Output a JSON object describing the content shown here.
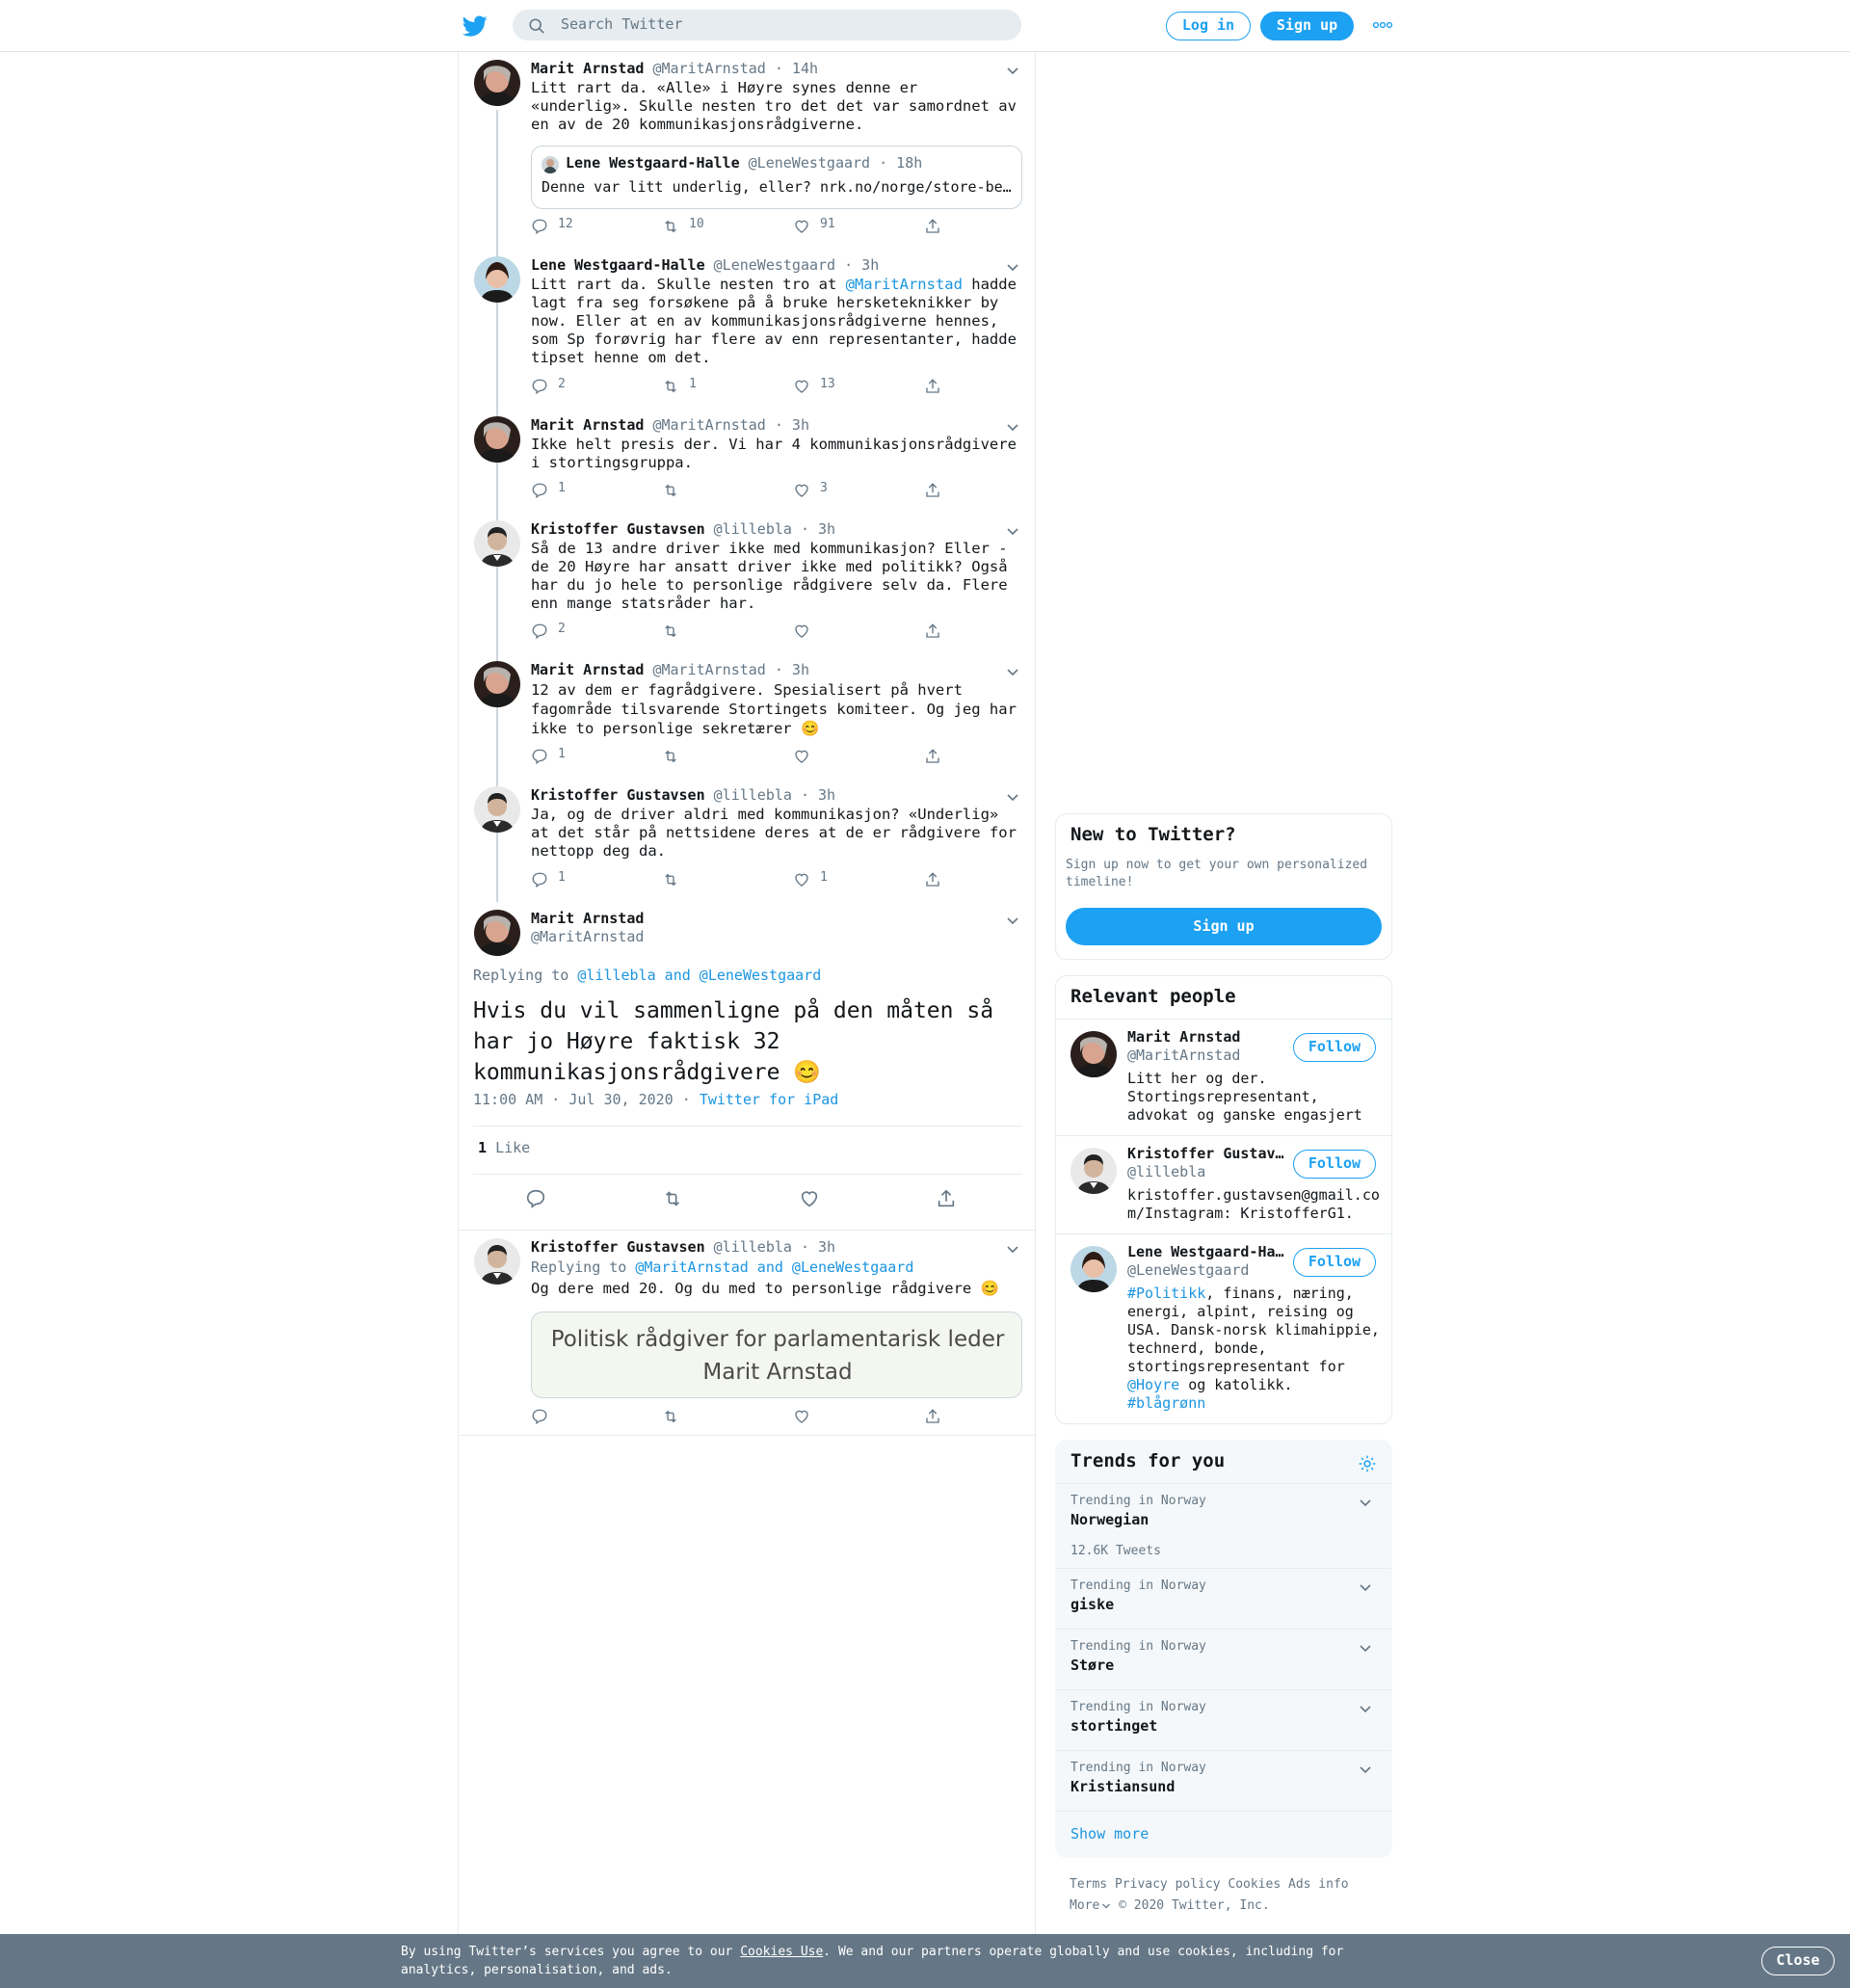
{
  "header": {
    "search_placeholder": "Search Twitter",
    "login": "Log in",
    "signup": "Sign up"
  },
  "thread": [
    {
      "name": "Marit Arnstad",
      "handle": "@MaritArnstad",
      "time": "· 14h",
      "text": "Litt rart da. «Alle» i Høyre synes denne er «underlig». Skulle nesten tro det det var samordnet av en av de 20 kommunikasjonsrådgiverne.",
      "quote": {
        "name": "Lene Westgaard-Halle",
        "handle": "@LeneWestgaard",
        "time": "· 18h",
        "text": "Denne var litt underlig, eller? nrk.no/norge/store-be…"
      },
      "replies": "12",
      "retweets": "10",
      "likes": "91"
    },
    {
      "name": "Lene Westgaard-Halle",
      "handle": "@LeneWestgaard",
      "time": "· 3h",
      "text_pre": "Litt rart da. Skulle nesten tro at ",
      "mention": "@MaritArnstad",
      "text_post": " hadde lagt fra seg forsøkene på å bruke hersketeknikker by now. Eller at en av kommunikasjonsrådgiverne hennes, som Sp forøvrig har flere av enn representanter, hadde tipset henne om det.",
      "replies": "2",
      "retweets": "1",
      "likes": "13"
    },
    {
      "name": "Marit Arnstad",
      "handle": "@MaritArnstad",
      "time": "· 3h",
      "text": "Ikke helt presis der. Vi har 4 kommunikasjonsrådgivere i stortingsgruppa.",
      "replies": "1",
      "retweets": "",
      "likes": "3"
    },
    {
      "name": "Kristoffer Gustavsen",
      "handle": "@lillebla",
      "time": "· 3h",
      "text": "Så de 13 andre driver ikke med kommunikasjon? Eller - de 20 Høyre har ansatt driver ikke med politikk? Også har du jo hele to personlige rådgivere selv da. Flere enn mange statsråder har.",
      "replies": "2",
      "retweets": "",
      "likes": ""
    },
    {
      "name": "Marit Arnstad",
      "handle": "@MaritArnstad",
      "time": "· 3h",
      "text": "12 av dem er fagrådgivere. Spesialisert på hvert fagområde tilsvarende Stortingets komiteer. Og jeg har ikke to personlige sekretærer 😊",
      "replies": "1",
      "retweets": "",
      "likes": ""
    },
    {
      "name": "Kristoffer Gustavsen",
      "handle": "@lillebla",
      "time": "· 3h",
      "text": "Ja, og de driver aldri med kommunikasjon? «Underlig» at det står på nettsidene deres at de er rådgivere for nettopp deg da.",
      "replies": "1",
      "retweets": "",
      "likes": "1"
    }
  ],
  "main_tweet": {
    "name": "Marit Arnstad",
    "handle": "@MaritArnstad",
    "replying_label": "Replying to",
    "replying_to": "@lillebla and @LeneWestgaard",
    "text": "Hvis du vil sammenligne på den måten så har jo Høyre faktisk 32 kommunikasjonsrådgivere 😊",
    "timestamp": "11:00 AM · Jul 30, 2020",
    "source": "Twitter for iPad",
    "likes_count": "1",
    "likes_label": "Like"
  },
  "reply": {
    "name": "Kristoffer Gustavsen",
    "handle": "@lillebla",
    "time": "· 3h",
    "replying_label": "Replying to",
    "replying_to": "@MaritArnstad and @LeneWestgaard",
    "text": "Og dere med 20. Og du med to personlige rådgivere 😊",
    "image_line1": "Politisk rådgiver for parlamentarisk leder",
    "image_line2": "Marit Arnstad"
  },
  "sidebar": {
    "new_title": "New to Twitter?",
    "new_text": "Sign up now to get your own personalized timeline!",
    "signup": "Sign up",
    "relevant_title": "Relevant people",
    "people": [
      {
        "name": "Marit Arnstad",
        "handle": "@MaritArnstad",
        "follow": "Follow",
        "bio": "Litt her og der. Stortingsrepresentant, advokat og ganske engasjert"
      },
      {
        "name": "Kristoffer Gustav…",
        "handle": "@lillebla",
        "follow": "Follow",
        "bio": "kristoffer.gustavsen@gmail.com/Instagram: KristofferG1."
      },
      {
        "name": "Lene Westgaard-Ha…",
        "handle": "@LeneWestgaard",
        "follow": "Follow",
        "bio_tag1": "#Politikk",
        "bio_mid": ", finans, næring, energi, alpint, reising og USA. Dansk-norsk klimahippie, technerd, bonde, stortingsrepresentant for ",
        "bio_mention": "@Hoyre",
        "bio_end": " og katolikk.",
        "bio_tag2": "#blågrønn"
      }
    ],
    "trends_title": "Trends for you",
    "trends": [
      {
        "label": "Trending in Norway",
        "name": "Norwegian",
        "count": "12.6K Tweets"
      },
      {
        "label": "Trending in Norway",
        "name": "giske"
      },
      {
        "label": "Trending in Norway",
        "name": "Støre"
      },
      {
        "label": "Trending in Norway",
        "name": "stortinget"
      },
      {
        "label": "Trending in Norway",
        "name": "Kristiansund"
      }
    ],
    "show_more": "Show more",
    "footer": {
      "terms": "Terms",
      "privacy": "Privacy policy",
      "cookies": "Cookies",
      "ads": "Ads info",
      "more": "More",
      "copyright": "© 2020 Twitter, Inc."
    }
  },
  "cookie_bar": {
    "pre": "By using Twitter’s services you agree to our ",
    "link": "Cookies Use",
    "post": ". We and our partners operate globally and use cookies, including for analytics, personalisation, and ads.",
    "close": "Close"
  },
  "colors": {
    "accent": "#1da1f2",
    "link": "#1b95e0",
    "text": "#14171a",
    "muted": "#657786",
    "cookie_bg": "#657786"
  }
}
